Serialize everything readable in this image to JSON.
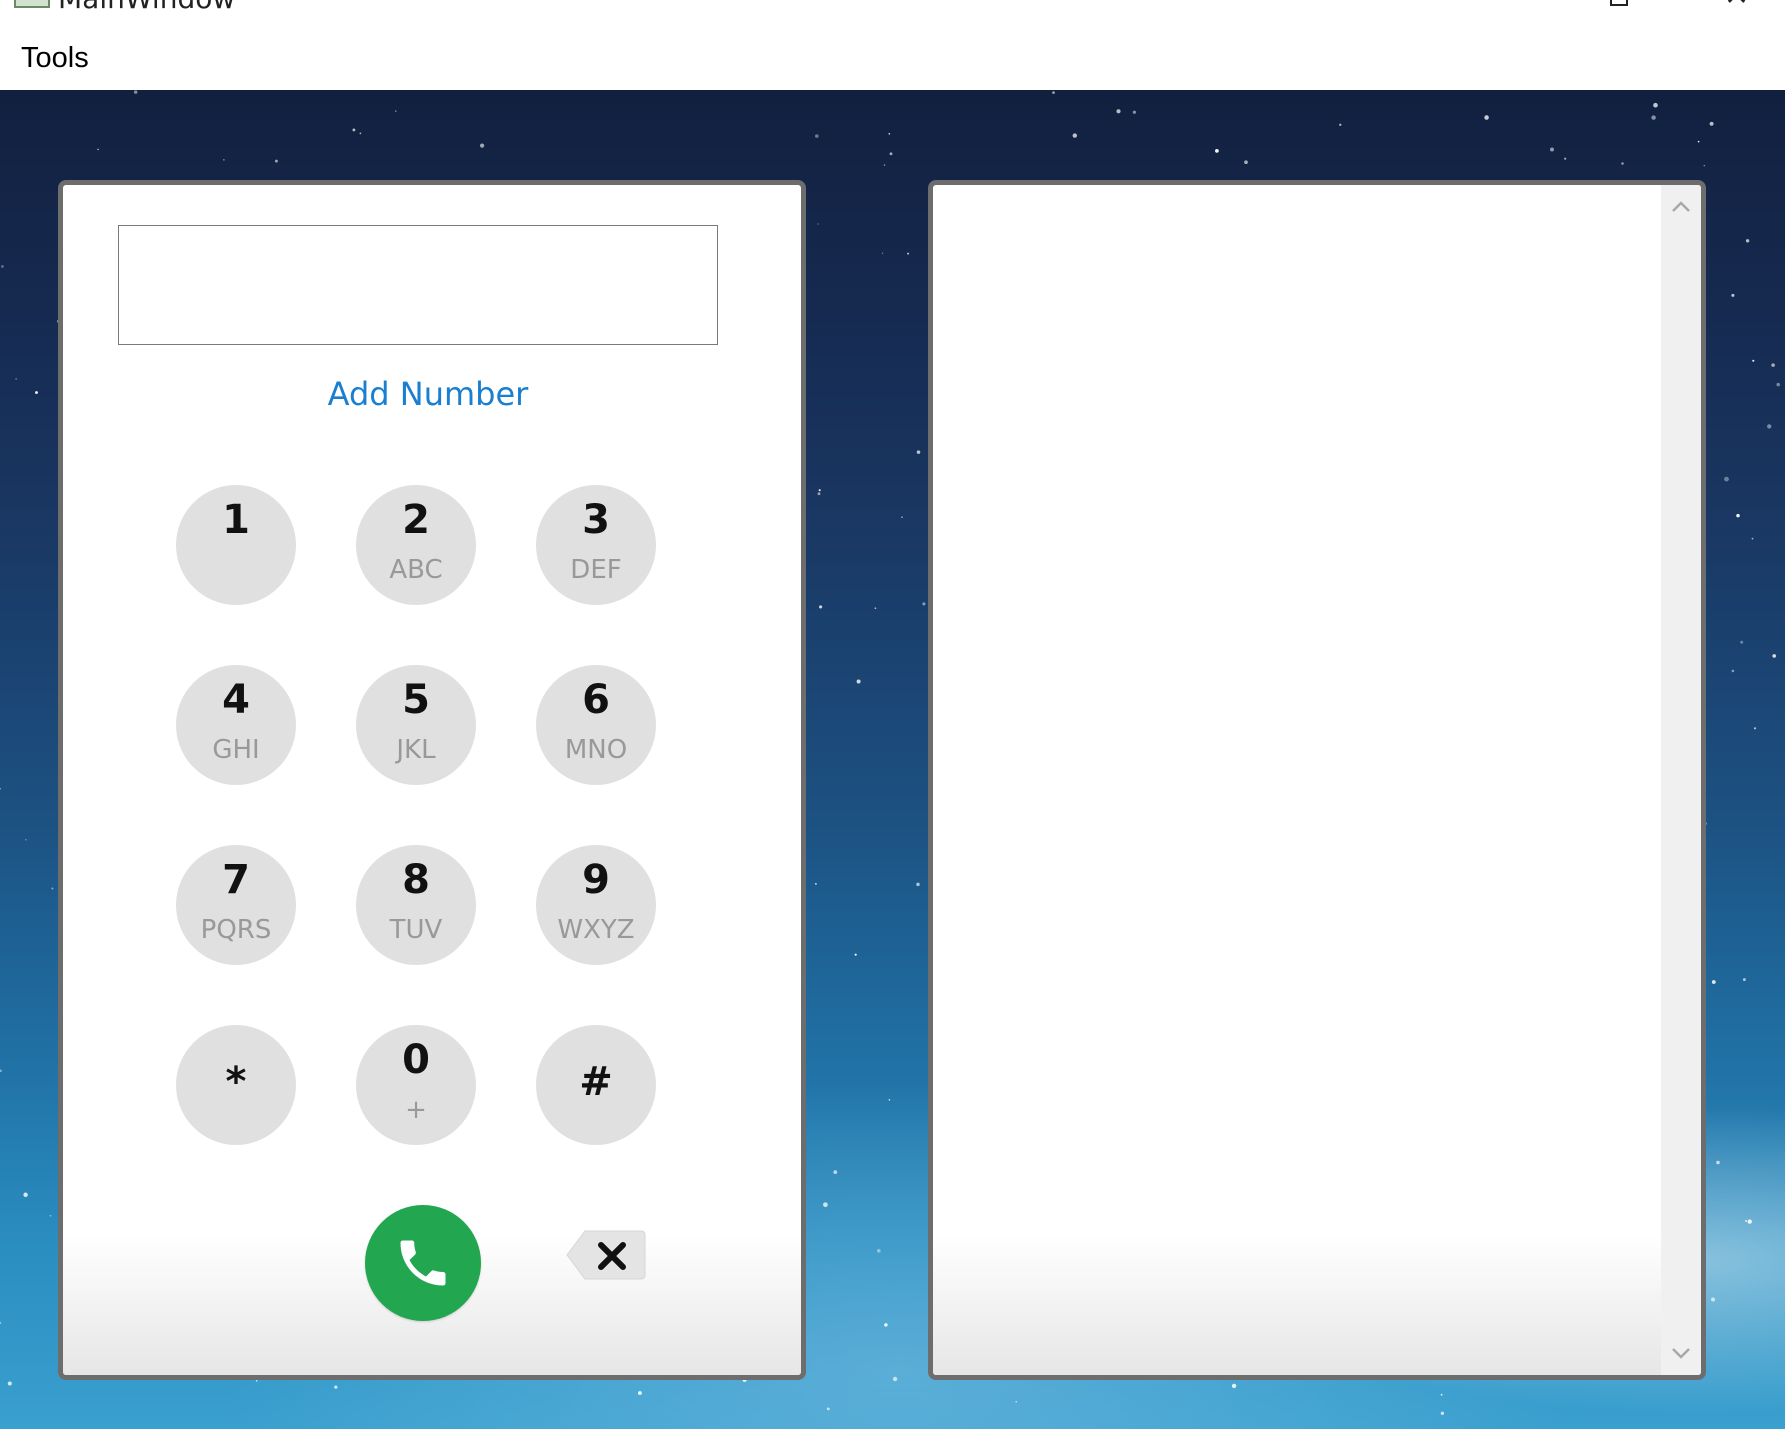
{
  "window": {
    "title": "MainWindow"
  },
  "menubar": {
    "items": [
      {
        "label": "Tools"
      }
    ]
  },
  "dialer": {
    "number_value": "",
    "add_number_label": "Add Number",
    "keys": [
      {
        "digit": "1",
        "letters": ""
      },
      {
        "digit": "2",
        "letters": "ABC"
      },
      {
        "digit": "3",
        "letters": "DEF"
      },
      {
        "digit": "4",
        "letters": "GHI"
      },
      {
        "digit": "5",
        "letters": "JKL"
      },
      {
        "digit": "6",
        "letters": "MNO"
      },
      {
        "digit": "7",
        "letters": "PQRS"
      },
      {
        "digit": "8",
        "letters": "TUV"
      },
      {
        "digit": "9",
        "letters": "WXYZ"
      },
      {
        "digit": "*",
        "letters": ""
      },
      {
        "digit": "0",
        "letters": "+"
      },
      {
        "digit": "#",
        "letters": ""
      }
    ],
    "call_icon": "phone-icon",
    "backspace_icon": "backspace-icon"
  },
  "colors": {
    "accent": "#1a7fd0",
    "call_green": "#22a650",
    "key_background": "#e0e0e0",
    "panel_border": "#6d6d6d"
  },
  "list_panel": {
    "items": []
  }
}
